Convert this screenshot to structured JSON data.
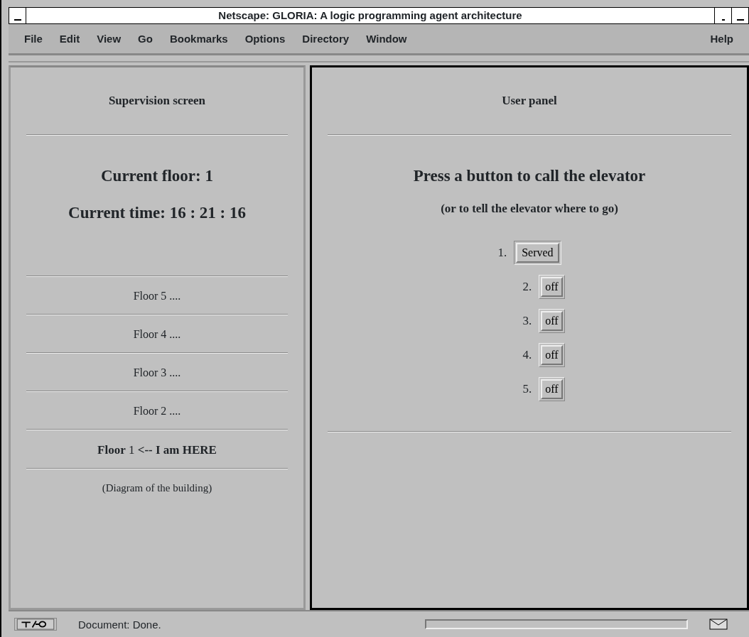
{
  "window": {
    "title": "Netscape: GLORIA: A logic programming agent architecture"
  },
  "menu": [
    "File",
    "Edit",
    "View",
    "Go",
    "Bookmarks",
    "Options",
    "Directory",
    "Window"
  ],
  "help_menu": "Help",
  "frames": {
    "left": {
      "selected": false,
      "heading": "Supervision screen",
      "current_floor": "Current floor: 1",
      "current_time": "Current time: 16 : 21 : 16",
      "floors": [
        {
          "text": "Floor 5 ....",
          "current": false
        },
        {
          "text": "Floor 4 ....",
          "current": false
        },
        {
          "text": "Floor 3 ....",
          "current": false
        },
        {
          "text": "Floor 2 ....",
          "current": false
        },
        {
          "text": "**Floor** 1 **<-- I am HERE**",
          "current": true
        }
      ],
      "caption": "(Diagram of the building)"
    },
    "right": {
      "selected": true,
      "heading": "User panel",
      "title": "Press a button to call the elevator",
      "subtitle": "(or to tell the elevator where to go)",
      "buttons": [
        {
          "number": "1.",
          "label": "Served",
          "selected": true
        },
        {
          "number": "2.",
          "label": "off",
          "selected": false
        },
        {
          "number": "3.",
          "label": "off",
          "selected": false
        },
        {
          "number": "4.",
          "label": "off",
          "selected": false
        },
        {
          "number": "5.",
          "label": "off",
          "selected": false
        }
      ]
    }
  },
  "status_bar": {
    "text": "Document: Done."
  }
}
